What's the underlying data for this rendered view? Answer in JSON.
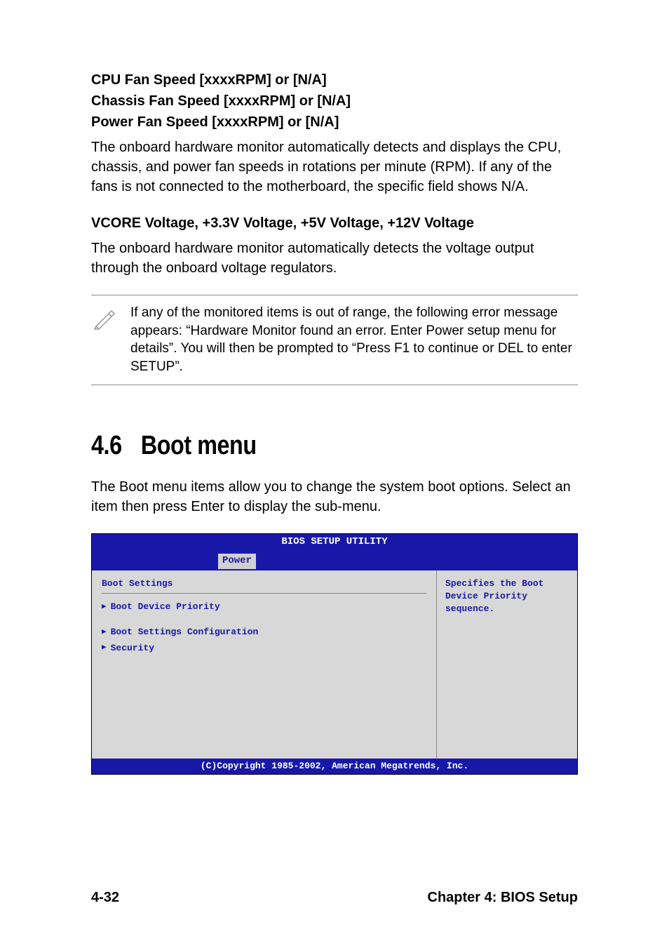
{
  "headings": {
    "cpu_fan": "CPU Fan Speed [xxxxRPM] or [N/A]",
    "chassis_fan": "Chassis Fan Speed [xxxxRPM] or [N/A]",
    "power_fan": "Power Fan Speed [xxxxRPM] or [N/A]",
    "voltage": "VCORE Voltage, +3.3V Voltage, +5V Voltage, +12V Voltage"
  },
  "paragraphs": {
    "fan_desc": "The onboard hardware monitor automatically detects and displays the CPU, chassis, and power fan speeds in rotations per minute (RPM). If any of the fans is not connected to the motherboard, the specific field shows N/A.",
    "voltage_desc": "The onboard hardware monitor automatically detects the voltage output through the onboard voltage regulators.",
    "note": "If any of the monitored items is out of range, the following error message appears: “Hardware Monitor found an error. Enter Power setup menu for details”. You will then be prompted to “Press F1 to continue or DEL to enter SETUP”.",
    "boot_desc": "The Boot menu items allow you to change the system boot options. Select an item then press Enter to display the sub-menu."
  },
  "section": {
    "number": "4.6",
    "title": "Boot menu"
  },
  "bios": {
    "header": "BIOS SETUP UTILITY",
    "tab": "Power",
    "section_title": "Boot Settings",
    "items": [
      "Boot Device Priority",
      "Boot Settings Configuration",
      "Security"
    ],
    "help_text": "Specifies the Boot Device Priority sequence.",
    "footer": "(C)Copyright 1985-2002, American Megatrends, Inc."
  },
  "footer": {
    "page": "4-32",
    "chapter": "Chapter 4: BIOS Setup"
  }
}
